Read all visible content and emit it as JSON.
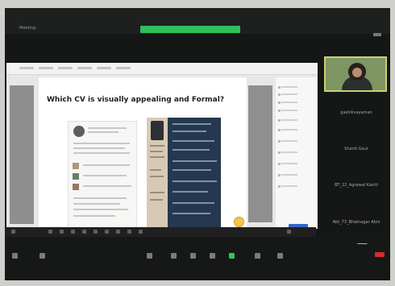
{
  "window": {
    "meeting_name": "Meeting"
  },
  "slide": {
    "title": "Which CV is visually appealing and Formal?"
  },
  "participants": [
    {
      "name": "gashikvayaman"
    },
    {
      "name": "Shanti Gaur"
    },
    {
      "name": "BT_22_Agrawal Kaniti"
    },
    {
      "name": "Abt_73_Bhatnagar Abni"
    }
  ],
  "colors": {
    "share_bar": "#2fbf5b",
    "end_button": "#d32c2c",
    "video_border": "#c6d36a"
  },
  "icons": {
    "mute": "microphone-icon",
    "video": "camera-icon",
    "chat": "chat-icon",
    "more": "more-icon",
    "share": "share-screen-icon",
    "end": "end-meeting-icon"
  }
}
